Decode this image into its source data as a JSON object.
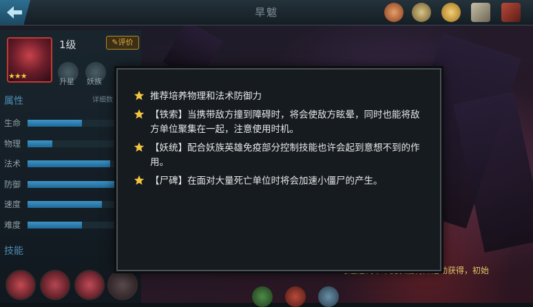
{
  "header": {
    "title": "旱魃"
  },
  "hero": {
    "level": "1级",
    "rate_label": "评价",
    "stars": "★★★"
  },
  "tabs": {
    "advance_label": "升星",
    "race_label": "妖族"
  },
  "attributes": {
    "section_title": "属性",
    "detail_label": "详细数",
    "stats": [
      {
        "label": "生命",
        "fraction": 0.62
      },
      {
        "label": "物理",
        "fraction": 0.28
      },
      {
        "label": "法术",
        "fraction": 0.94
      },
      {
        "label": "防御",
        "fraction": 1.0
      },
      {
        "label": "速度",
        "fraction": 0.84
      },
      {
        "label": "难度",
        "fraction": 0.62
      }
    ]
  },
  "skills": {
    "section_title": "技能"
  },
  "bottom_hint": "可通过代币币扰表能特殊活动获得，初始",
  "tips_dialog": {
    "tips": [
      {
        "text": "推荐培养物理和法术防御力"
      },
      {
        "text": "【铁索】当携带敌方撞到障碍时，将会使敌方眩晕，同时也能将敌方单位聚集在一起，注意使用时机。"
      },
      {
        "text": "【妖统】配合妖族英雄免疫部分控制技能也许会起到意想不到的作用。"
      },
      {
        "text": "【尸碑】在面对大量死亡单位时将会加速小僵尸的产生。"
      }
    ]
  },
  "colors": {
    "accent_blue": "#3f93c7",
    "gold": "#f4c542",
    "dialog_bg": "#161b1f"
  },
  "icons": [
    "back-arrow-icon",
    "scroll-icon",
    "coin-icon",
    "book-icon",
    "gift-icon",
    "star-icon"
  ]
}
